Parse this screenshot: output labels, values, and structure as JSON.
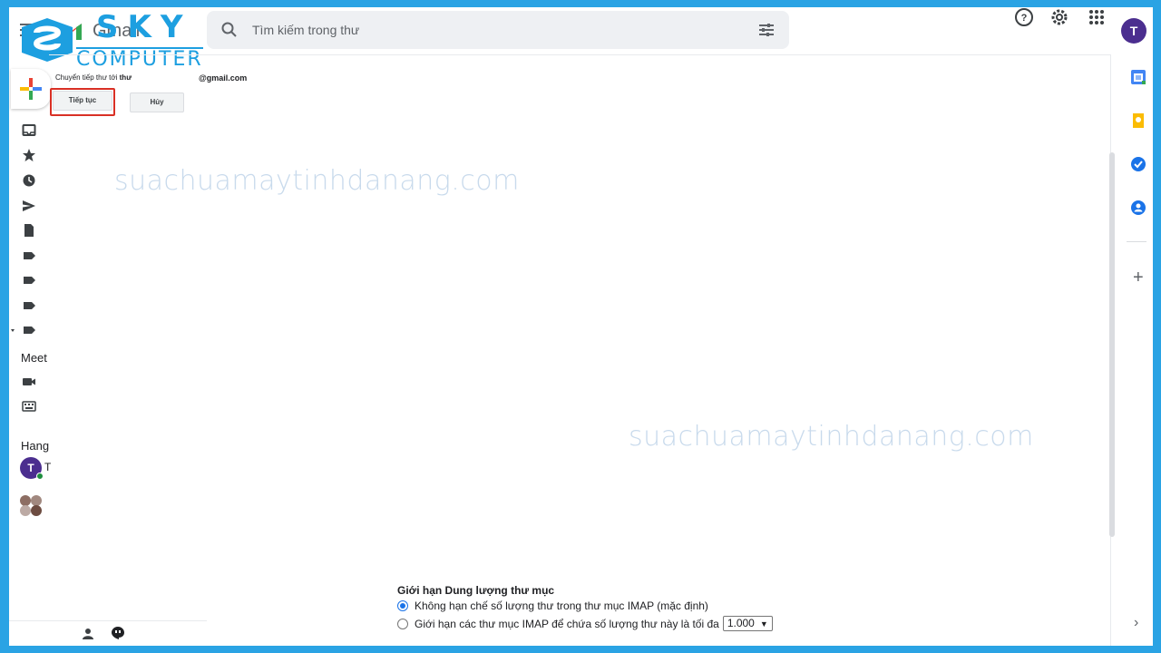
{
  "search": {
    "placeholder": "Tìm kiếm trong thư"
  },
  "brand": {
    "gmail_word": "Gmail",
    "sky": "SKY",
    "computer": "COMPUTER"
  },
  "user": {
    "initial": "T"
  },
  "sidebar": {
    "meet_label": "Meet",
    "hangouts_label": "Hang",
    "hangouts_user_initial": "T",
    "hangouts_user_name": "T"
  },
  "forwarding": {
    "label_prefix": "Chuyển tiếp thư tới ",
    "label_bold": "thư",
    "email": "@gmail.com",
    "continue_label": "Tiếp tục",
    "cancel_label": "Hủy"
  },
  "watermarks": [
    "suachuamaytinhdanang.com",
    "suachuamaytinhdanang.com"
  ],
  "imap": {
    "title": "Giới hạn Dung lượng thư mục",
    "option1": "Không hạn chế số lượng thư trong thư mục IMAP (mặc định)",
    "option2": "Giới hạn các thư mục IMAP để chứa số lượng thư này là tối đa",
    "limit_value": "1.000",
    "option1_selected": true
  },
  "colors": {
    "accent": "#1a73e8",
    "frame": "#2aa3e4",
    "highlight": "#d93025",
    "brand": "#1d9fe0"
  }
}
